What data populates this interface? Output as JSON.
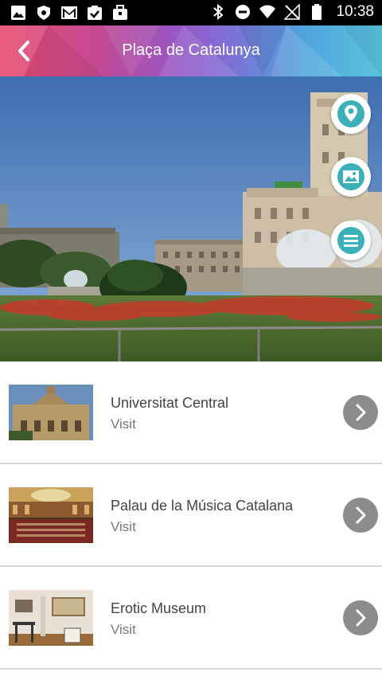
{
  "status_bar": {
    "time": "10:38"
  },
  "header": {
    "title": "Plaça de Catalunya"
  },
  "places": [
    {
      "name": "Universitat Central",
      "action": "Visit"
    },
    {
      "name": "Palau de la Música Catalana",
      "action": "Visit"
    },
    {
      "name": "Erotic Museum",
      "action": "Visit"
    }
  ],
  "colors": {
    "fab_accent": "#3bb0b8",
    "arrow_bg": "#8c8c8c",
    "divider": "#d8d8d8"
  }
}
